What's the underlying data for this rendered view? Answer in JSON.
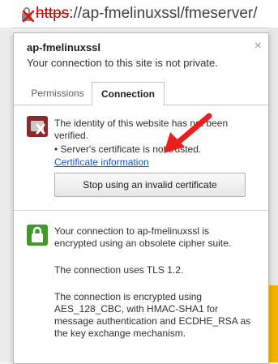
{
  "address_bar": {
    "scheme": "https",
    "rest": "://ap-fmelinuxssl/fmeserver/",
    "icon": "insecure-lock-icon"
  },
  "popup": {
    "site_name": "ap-fmelinuxssl",
    "subtitle": "Your connection to this site is not private.",
    "close_label": "×",
    "tabs": [
      {
        "label": "Permissions",
        "active": false
      },
      {
        "label": "Connection",
        "active": true
      }
    ],
    "identity": {
      "icon": "identity-error-icon",
      "text": "The identity of this website has not been verified.",
      "bullet": "• Server's certificate is not trusted.",
      "link": "Certificate information",
      "button": "Stop using an invalid certificate"
    },
    "encryption": {
      "icon": "secure-lock-icon",
      "line1": "Your connection to ap-fmelinuxssl is encrypted using an obsolete cipher suite.",
      "line2": "The connection uses TLS 1.2.",
      "line3": "The connection is encrypted using AES_128_CBC, with HMAC-SHA1 for message authentication and ECDHE_RSA as the key exchange mechanism."
    }
  },
  "colors": {
    "error_badge": "#8b2a2a",
    "secure_badge": "#3f9a2a",
    "link": "#1155cc",
    "annotation_arrow": "#e8201e"
  }
}
